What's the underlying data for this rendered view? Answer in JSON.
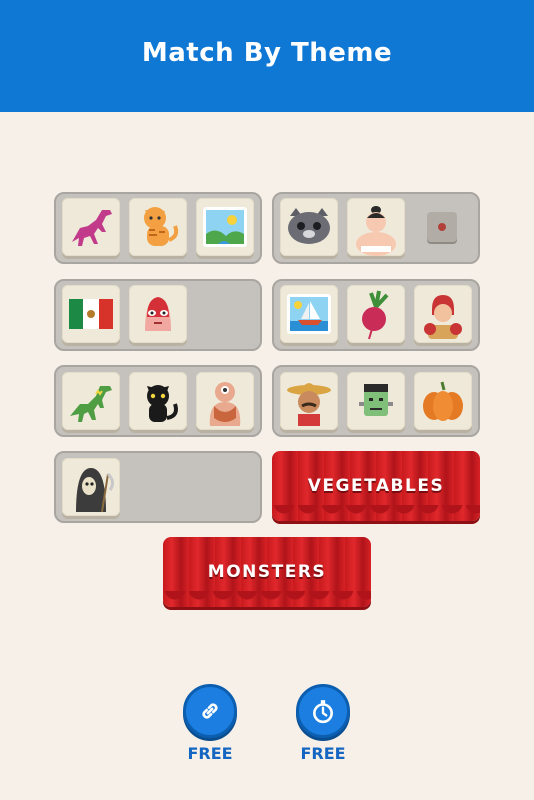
{
  "header": {
    "title": "Match By Theme"
  },
  "themes": [
    {
      "label": "VEGETABLES"
    },
    {
      "label": "MONSTERS"
    }
  ],
  "tiles": [
    {
      "icon": "dinosaur-pink-icon"
    },
    {
      "icon": "tiger-cat-icon"
    },
    {
      "icon": "landscape-picture-icon"
    },
    {
      "icon": "grey-cat-icon"
    },
    {
      "icon": "sumo-wrestler-icon"
    },
    {
      "icon": "japan-flag-icon"
    },
    {
      "icon": "mexico-flag-icon"
    },
    {
      "icon": "wrestler-mask-icon"
    },
    {
      "icon": "sailboat-picture-icon"
    },
    {
      "icon": "radish-icon"
    },
    {
      "icon": "boxer-icon"
    },
    {
      "icon": "dinosaur-green-icon"
    },
    {
      "icon": "black-cat-icon"
    },
    {
      "icon": "cyclops-icon"
    },
    {
      "icon": "mexican-man-icon"
    },
    {
      "icon": "frankenstein-icon"
    },
    {
      "icon": "pumpkin-icon"
    },
    {
      "icon": "grim-reaper-icon"
    }
  ],
  "boosters": [
    {
      "icon": "link-icon",
      "label": "FREE"
    },
    {
      "icon": "stopwatch-icon",
      "label": "FREE"
    }
  ],
  "colors": {
    "header": "#0f78d4",
    "background": "#f6f0e8",
    "curtain": "#d82226",
    "booster": "#1b7ee0"
  }
}
